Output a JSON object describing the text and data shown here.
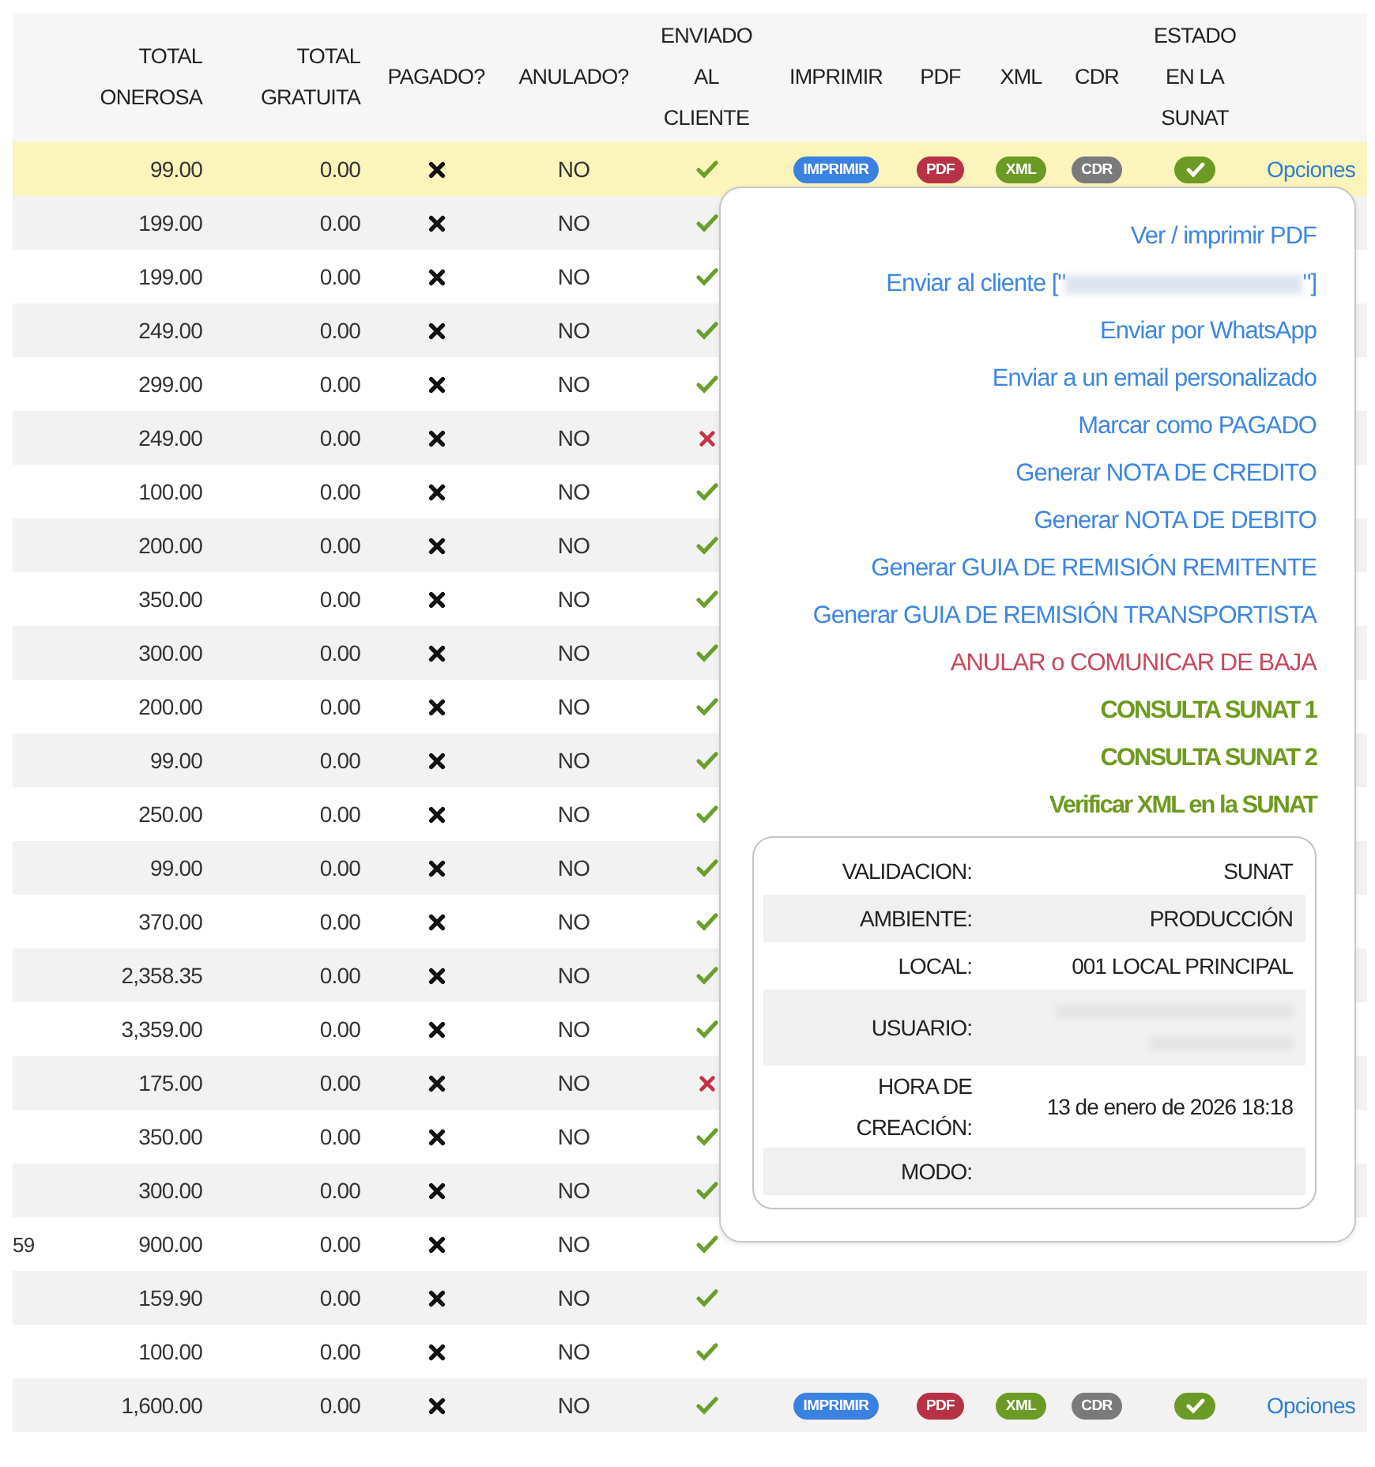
{
  "table": {
    "columns": [
      "TOTAL ONEROSA",
      "TOTAL GRATUITA",
      "PAGADO?",
      "ANULADO?",
      "ENVIADO AL CLIENTE",
      "IMPRIMIR",
      "PDF",
      "XML",
      "CDR",
      "ESTADO EN LA SUNAT"
    ],
    "rows": [
      {
        "selected": true,
        "onerosa": "99.00",
        "gratuita": "0.00",
        "paid": false,
        "anulado": "NO",
        "sent": true,
        "actions": {
          "print": "IMPRIMIR",
          "pdf": "PDF",
          "xml": "XML",
          "cdr": "CDR",
          "sunat_ok": true,
          "options": "Opciones"
        }
      },
      {
        "selected": false,
        "onerosa": "199.00",
        "gratuita": "0.00",
        "paid": false,
        "anulado": "NO",
        "sent": true
      },
      {
        "selected": false,
        "onerosa": "199.00",
        "gratuita": "0.00",
        "paid": false,
        "anulado": "NO",
        "sent": true
      },
      {
        "selected": false,
        "onerosa": "249.00",
        "gratuita": "0.00",
        "paid": false,
        "anulado": "NO",
        "sent": true
      },
      {
        "selected": false,
        "onerosa": "299.00",
        "gratuita": "0.00",
        "paid": false,
        "anulado": "NO",
        "sent": true
      },
      {
        "selected": false,
        "onerosa": "249.00",
        "gratuita": "0.00",
        "paid": false,
        "anulado": "NO",
        "sent": false
      },
      {
        "selected": false,
        "onerosa": "100.00",
        "gratuita": "0.00",
        "paid": false,
        "anulado": "NO",
        "sent": true
      },
      {
        "selected": false,
        "onerosa": "200.00",
        "gratuita": "0.00",
        "paid": false,
        "anulado": "NO",
        "sent": true
      },
      {
        "selected": false,
        "onerosa": "350.00",
        "gratuita": "0.00",
        "paid": false,
        "anulado": "NO",
        "sent": true
      },
      {
        "selected": false,
        "onerosa": "300.00",
        "gratuita": "0.00",
        "paid": false,
        "anulado": "NO",
        "sent": true
      },
      {
        "selected": false,
        "onerosa": "200.00",
        "gratuita": "0.00",
        "paid": false,
        "anulado": "NO",
        "sent": true
      },
      {
        "selected": false,
        "onerosa": "99.00",
        "gratuita": "0.00",
        "paid": false,
        "anulado": "NO",
        "sent": true
      },
      {
        "selected": false,
        "onerosa": "250.00",
        "gratuita": "0.00",
        "paid": false,
        "anulado": "NO",
        "sent": true
      },
      {
        "selected": false,
        "onerosa": "99.00",
        "gratuita": "0.00",
        "paid": false,
        "anulado": "NO",
        "sent": true
      },
      {
        "selected": false,
        "onerosa": "370.00",
        "gratuita": "0.00",
        "paid": false,
        "anulado": "NO",
        "sent": true
      },
      {
        "selected": false,
        "onerosa": "2,358.35",
        "gratuita": "0.00",
        "paid": false,
        "anulado": "NO",
        "sent": true
      },
      {
        "selected": false,
        "onerosa": "3,359.00",
        "gratuita": "0.00",
        "paid": false,
        "anulado": "NO",
        "sent": true
      },
      {
        "selected": false,
        "onerosa": "175.00",
        "gratuita": "0.00",
        "paid": false,
        "anulado": "NO",
        "sent": false
      },
      {
        "selected": false,
        "onerosa": "350.00",
        "gratuita": "0.00",
        "paid": false,
        "anulado": "NO",
        "sent": true
      },
      {
        "selected": false,
        "onerosa": "300.00",
        "gratuita": "0.00",
        "paid": false,
        "anulado": "NO",
        "sent": true
      },
      {
        "selected": false,
        "column_1": "59",
        "onerosa": "900.00",
        "gratuita": "0.00",
        "paid": false,
        "anulado": "NO",
        "sent": true
      },
      {
        "selected": false,
        "onerosa": "159.90",
        "gratuita": "0.00",
        "paid": false,
        "anulado": "NO",
        "sent": true
      },
      {
        "selected": false,
        "onerosa": "100.00",
        "gratuita": "0.00",
        "paid": false,
        "anulado": "NO",
        "sent": true
      },
      {
        "selected": false,
        "onerosa": "1,600.00",
        "gratuita": "0.00",
        "paid": false,
        "anulado": "NO",
        "sent": true,
        "actions": {
          "print": "IMPRIMIR",
          "pdf": "PDF",
          "xml": "XML",
          "cdr": "CDR",
          "sunat_ok": true,
          "options": "Opciones"
        }
      }
    ]
  },
  "options_menu": {
    "items": [
      {
        "kind": "link",
        "text": "Ver / imprimir PDF"
      },
      {
        "kind": "link",
        "text": "Enviar al cliente [\"",
        "redacted": true,
        "suffix": "\"]"
      },
      {
        "kind": "link",
        "text": "Enviar por WhatsApp"
      },
      {
        "kind": "link",
        "text": "Enviar a un email personalizado"
      },
      {
        "kind": "link",
        "text": "Marcar como PAGADO"
      },
      {
        "kind": "link",
        "text": "Generar NOTA DE CREDITO"
      },
      {
        "kind": "link",
        "text": "Generar NOTA DE DEBITO"
      },
      {
        "kind": "link",
        "text": "Generar GUIA DE REMISIÓN REMITENTE"
      },
      {
        "kind": "link",
        "text": "Generar GUIA DE REMISIÓN TRANSPORTISTA"
      },
      {
        "kind": "danger",
        "text": "ANULAR o COMUNICAR DE BAJA"
      },
      {
        "kind": "sunat",
        "text": "CONSULTA SUNAT 1"
      },
      {
        "kind": "sunat",
        "text": "CONSULTA SUNAT 2"
      },
      {
        "kind": "sunat",
        "text": "Verificar XML en la SUNAT"
      }
    ],
    "details": [
      {
        "label": "VALIDACION:",
        "value": "SUNAT"
      },
      {
        "label": "AMBIENTE:",
        "value": "PRODUCCIÓN"
      },
      {
        "label": "LOCAL:",
        "value": "001 LOCAL PRINCIPAL"
      },
      {
        "label": "USUARIO:",
        "redacted": true
      },
      {
        "label": "HORA DE CREACIÓN:",
        "value": "13 de enero de 2026 18:18"
      },
      {
        "label": "MODO:"
      }
    ]
  }
}
